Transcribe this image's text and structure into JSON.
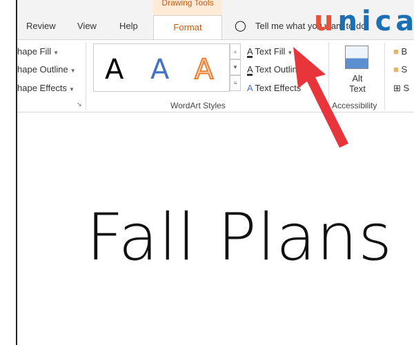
{
  "ribbon": {
    "context_tab": "Drawing Tools",
    "tabs": [
      "Review",
      "View",
      "Help",
      "Format"
    ],
    "tell_me": "Tell me what you want to do",
    "shape": {
      "fill": "hape Fill",
      "outline": "hape Outline",
      "effects": "hape Effects"
    },
    "wordart": {
      "sample": "A",
      "group_label": "WordArt Styles",
      "text_fill": "Text Fill",
      "text_outline": "Text Outline",
      "text_effects": "Text Effects"
    },
    "accessibility": {
      "alt1": "Alt",
      "alt2": "Text",
      "group_label": "Accessibility"
    },
    "arrange": [
      "B",
      "S",
      "S"
    ]
  },
  "document": {
    "title": "Fall Plans"
  },
  "logo": {
    "text": "unica",
    "color_u": "#e5533d",
    "color_rest": "#1a6fb5"
  },
  "annotation": {
    "arrow_color": "#e8353b"
  }
}
